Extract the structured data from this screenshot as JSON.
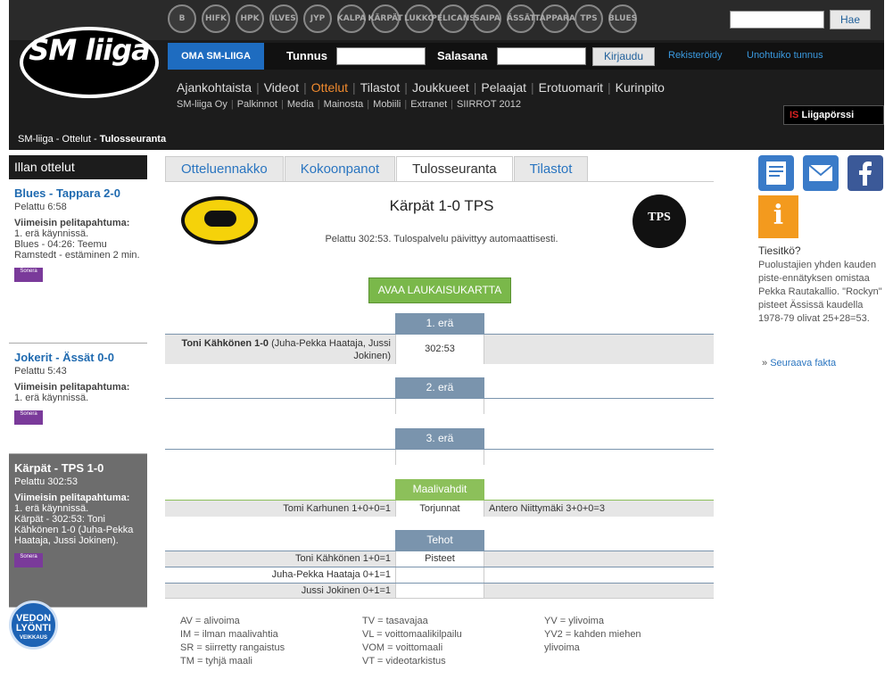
{
  "header": {
    "logo_text": "SM liiga",
    "team_logos": [
      "B",
      "HIFK",
      "HPK",
      "ILVES",
      "JYP",
      "KALPA",
      "KÄRPÄT",
      "LUKKO",
      "PELICANS",
      "SAIPA",
      "ÄSSÄT",
      "TAPPARA",
      "TPS",
      "BLUES"
    ],
    "search_button": "Hae",
    "oma_tab": "OMA SM-LIIGA",
    "username_label": "Tunnus",
    "password_label": "Salasana",
    "login_button": "Kirjaudu",
    "register_link": "Rekisteröidy",
    "forgot_link": "Unohtuiko tunnus",
    "main_nav": [
      "Ajankohtaista",
      "Videot",
      "Ottelut",
      "Tilastot",
      "Joukkueet",
      "Pelaajat",
      "Erotuomarit",
      "Kurinpito"
    ],
    "main_nav_active": "Ottelut",
    "sub_nav": [
      "SM-liiga Oy",
      "Palkinnot",
      "Media",
      "Mainosta",
      "Mobiili",
      "Extranet",
      "SIIRROT 2012"
    ],
    "liigaporssi_prefix": "IS",
    "liigaporssi": "Liigapörssi"
  },
  "breadcrumb": {
    "part1": "SM-liiga",
    "sep": " - ",
    "part2": "Ottelut",
    "current": "Tulosseuranta"
  },
  "left": {
    "title": "Illan ottelut",
    "games": [
      {
        "title": "Blues - Tappara 2-0",
        "played": "Pelattu 6:58",
        "event_label": "Viimeisin pelitapahtuma:",
        "event_line1": "1. erä käynnissä.",
        "event_line2": "Blues - 04:26: Teemu Ramstedt - estäminen 2 min."
      },
      {
        "title": "Jokerit - Ässät 0-0",
        "played": "Pelattu 5:43",
        "event_label": "Viimeisin pelitapahtuma:",
        "event_line1": "1. erä käynnissä.",
        "event_line2": ""
      },
      {
        "title": "Kärpät - TPS 1-0",
        "played": "Pelattu 302:53",
        "event_label": "Viimeisin pelitapahtuma:",
        "event_line1": "1. erä käynnissä.",
        "event_line2": "Kärpät - 302:53: Toni Kähkönen 1-0 (Juha-Pekka Haataja, Jussi Jokinen)."
      }
    ],
    "sonera_text": "Sonera",
    "vedon_line1": "VEDON",
    "vedon_line2": "LYÖNTI",
    "vedon_line3": "VEIKKAUS"
  },
  "tabs": [
    "Otteluennakko",
    "Kokoonpanot",
    "Tulosseuranta",
    "Tilastot"
  ],
  "tabs_active": "Tulosseuranta",
  "match": {
    "home_logo": "KÄRPÄT",
    "away_logo": "TPS",
    "title": "Kärpät 1-0 TPS",
    "status": "Pelattu 302:53. Tulospalvelu päivittyy automaattisesti.",
    "shotmap_button": "AVAA LAUKAISUKARTTA"
  },
  "periods": [
    {
      "label": "1. erä",
      "events": [
        {
          "left_bold": "Toni Kähkönen 1-0",
          "left_rest": "(Juha-Pekka Haataja, Jussi Jokinen)",
          "time": "302:53",
          "right": ""
        }
      ]
    },
    {
      "label": "2. erä",
      "events": []
    },
    {
      "label": "3. erä",
      "events": []
    }
  ],
  "goalies": {
    "label": "Maalivahdit",
    "left": "Tomi Karhunen 1+0+0=1",
    "mid": "Torjunnat",
    "right": "Antero Niittymäki 3+0+0=3"
  },
  "points": {
    "label": "Tehot",
    "mid_label": "Pisteet",
    "rows": [
      "Toni Kähkönen 1+0=1",
      "Juha-Pekka Haataja 0+1=1",
      "Jussi Jokinen 0+1=1"
    ]
  },
  "legend": {
    "col1": [
      "AV = alivoima",
      "IM = ilman maalivahtia",
      "SR = siirretty rangaistus",
      "TM = tyhjä maali"
    ],
    "col2": [
      "TV = tasavajaa",
      "VL = voittomaalikilpailu",
      "VOM = voittomaali",
      "VT = videotarkistus"
    ],
    "col3": [
      "YV = ylivoima",
      "YV2 = kahden miehen ylivoima"
    ]
  },
  "right": {
    "fact_title": "Tiesitkö?",
    "fact_text": "Puolustajien yhden kauden piste-ennätyksen omistaa Pekka Rautakallio. \"Rockyn\" pisteet Ässissä kaudella 1978-79 olivat 25+28=53.",
    "next_fact": "Seuraava fakta"
  },
  "colors": {
    "header_bg": "#1c1c1c",
    "accent_blue": "#1e6cc0",
    "accent_orange": "#f08a2e",
    "period_header": "#7a94ad",
    "green": "#8cc05a"
  }
}
